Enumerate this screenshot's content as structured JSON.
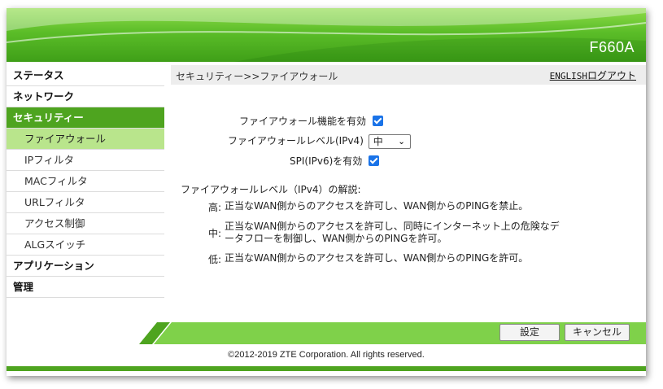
{
  "header": {
    "model": "F660A"
  },
  "sidebar": {
    "items": [
      {
        "label": "ステータス"
      },
      {
        "label": "ネットワーク"
      },
      {
        "label": "セキュリティー"
      },
      {
        "label": "アプリケーション"
      },
      {
        "label": "管理"
      }
    ],
    "security_sub": [
      {
        "label": "ファイアウォール"
      },
      {
        "label": "IPフィルタ"
      },
      {
        "label": "MACフィルタ"
      },
      {
        "label": "URLフィルタ"
      },
      {
        "label": "アクセス制御"
      },
      {
        "label": "ALGスイッチ"
      }
    ],
    "active_item": "セキュリティー",
    "active_sub": "ファイアウォール"
  },
  "main": {
    "breadcrumb": "セキュリティー>>ファイアウォール",
    "english_link": "ENGLISH",
    "logout_link": "ログアウト",
    "firewall_enable_label": "ファイアウォール機能を有効",
    "firewall_enable_checked": true,
    "firewall_level_label": "ファイアウォールレベル(IPv4)",
    "firewall_level_value": "中",
    "spi_label": "SPI(IPv6)を有効",
    "spi_checked": true,
    "desc_title": "ファイアウォールレベル（IPv4）の解説:",
    "levels": [
      {
        "key": "高:",
        "text": "正当なWAN側からのアクセスを許可し、WAN側からのPINGを禁止。"
      },
      {
        "key": "中:",
        "text": "正当なWAN側からのアクセスを許可し、同時にインターネット上の危険なデータフローを制御し、WAN側からのPINGを許可。"
      },
      {
        "key": "低:",
        "text": "正当なWAN側からのアクセスを許可し、WAN側からのPINGを許可。"
      }
    ]
  },
  "footer": {
    "apply_label": "設定",
    "cancel_label": "キャンセル",
    "copyright": "©2012-2019 ZTE Corporation. All rights reserved."
  },
  "colors": {
    "brand_green": "#4ea41f",
    "active_sub_bg": "#b9e58c",
    "footer_green": "#7fd14a",
    "checkbox_blue": "#1a73e8"
  },
  "icons": {
    "select_arrow": "chevron-down-icon",
    "checkbox": "checkmark-icon"
  }
}
